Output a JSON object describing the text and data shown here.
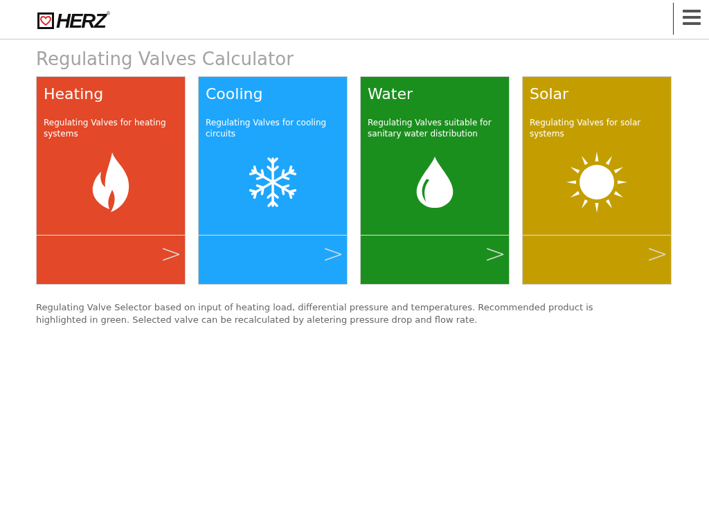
{
  "header": {
    "logo": {
      "text": "HERZ",
      "mark": "®"
    }
  },
  "title": "Regulating Valves Calculator",
  "cards": [
    {
      "kind": "heating",
      "title": "Heating",
      "description": "Regulating Valves for heating systems",
      "arrow": ">",
      "color": "#e34828"
    },
    {
      "kind": "cooling",
      "title": "Cooling",
      "description": "Regulating Valves for cooling circuits",
      "arrow": ">",
      "color": "#1ea6fc"
    },
    {
      "kind": "water",
      "title": "Water",
      "description": "Regulating Valves suitable for sanitary water distribution",
      "arrow": ">",
      "color": "#1b8f1e"
    },
    {
      "kind": "solar",
      "title": "Solar",
      "description": "Regulating Valves for solar systems",
      "arrow": ">",
      "color": "#c49e00"
    }
  ],
  "description": "Regulating Valve Selector based on input of heating load, differential pressure and temperatures. Recommended product is highlighted in green. Selected valve can be recalculated by aletering pressure drop and flow rate."
}
